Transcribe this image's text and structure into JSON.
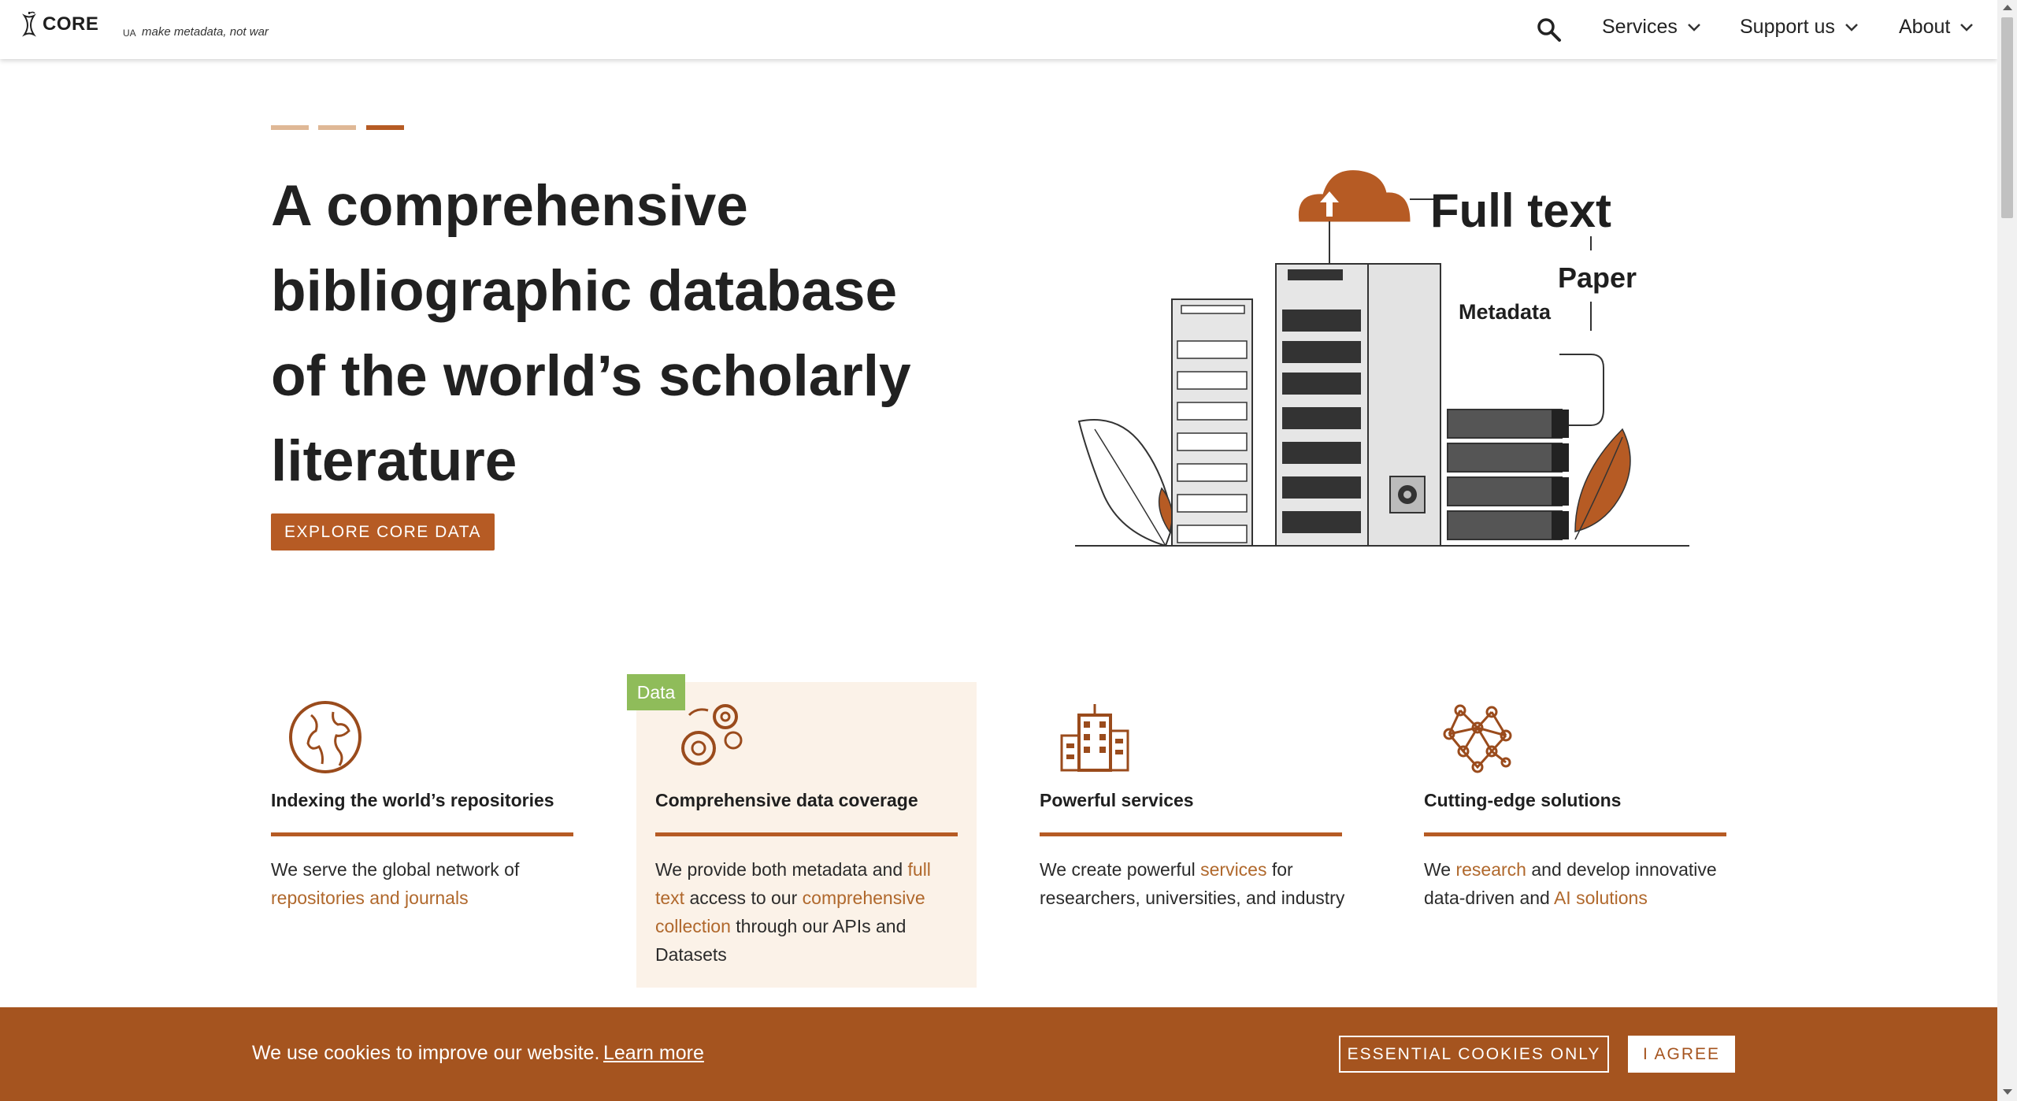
{
  "header": {
    "logo_text": "CORE",
    "ua_label": "UA",
    "tagline": "make metadata, not war",
    "nav": [
      {
        "label": "Services"
      },
      {
        "label": "Support us"
      },
      {
        "label": "About"
      }
    ]
  },
  "hero": {
    "title": "A comprehensive bibliographic database of the world’s scholarly literature",
    "cta_label": "EXPLORE CORE DATA",
    "illustration_labels": {
      "full_text": "Full text",
      "paper": "Paper",
      "metadata": "Metadata"
    }
  },
  "features": [
    {
      "title": "Indexing the world’s repositories",
      "desc": [
        {
          "text": "We serve the global network of "
        },
        {
          "text": "repositories and journals",
          "link": true
        }
      ]
    },
    {
      "badge": "Data",
      "title": "Comprehensive data coverage",
      "desc": [
        {
          "text": "We provide both metadata and "
        },
        {
          "text": "full text",
          "link": true
        },
        {
          "text": " access to our "
        },
        {
          "text": "comprehensive collection",
          "link": true
        },
        {
          "text": " through our APIs and Datasets"
        }
      ]
    },
    {
      "title": "Powerful services",
      "desc": [
        {
          "text": "We create powerful "
        },
        {
          "text": "services",
          "link": true
        },
        {
          "text": " for researchers, universities, and industry"
        }
      ]
    },
    {
      "title": "Cutting-edge solutions",
      "desc": [
        {
          "text": "We "
        },
        {
          "text": "research",
          "link": true
        },
        {
          "text": " and develop innovative data-driven and "
        },
        {
          "text": "AI solutions",
          "link": true
        }
      ]
    }
  ],
  "cookie_bar": {
    "message": "We use cookies to improve our website.",
    "learn_more": "Learn more",
    "essential_label": "ESSENTIAL COOKIES ONLY",
    "agree_label": "I AGREE"
  },
  "colors": {
    "accent": "#b65b24",
    "cookie_bg": "#a5541f",
    "badge_green": "#8fbc5a",
    "highlight_bg": "#fbf2e8"
  }
}
